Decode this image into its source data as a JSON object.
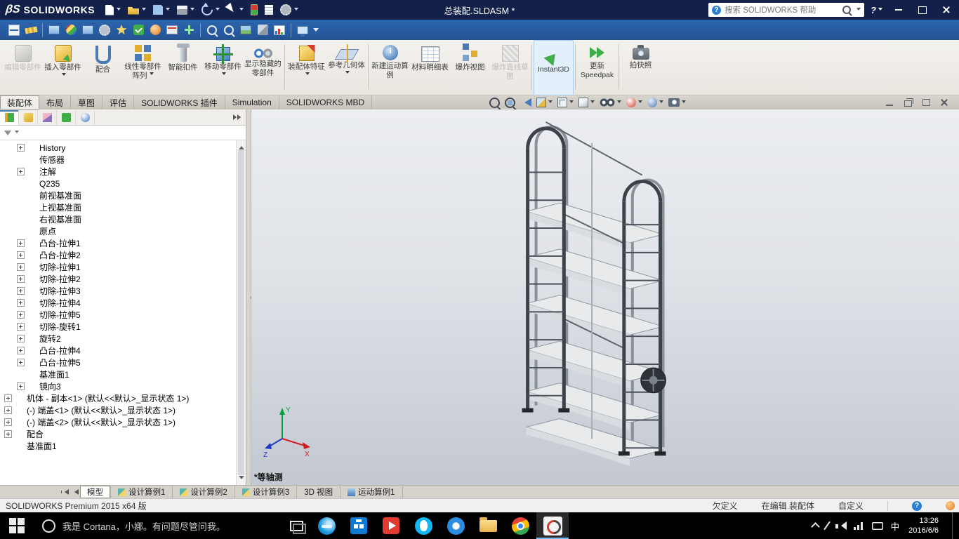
{
  "colors": {
    "titlebar": "#13204a",
    "toolbar": "#2a5fa8",
    "ribbon_bg": "#eceae5",
    "viewport_top": "#eceef1",
    "viewport_bottom": "#c3c8d1",
    "taskbar": "#000000",
    "taskbar_active_underline": "#76b9ed"
  },
  "titlebar": {
    "logo_mark": "βS",
    "logo_text": "SOLIDWORKS",
    "doc_title": "总装配.SLDASM *",
    "search_placeholder": "搜索 SOLIDWORKS 帮助",
    "quick_access": [
      {
        "name": "new-file-icon",
        "caret": true
      },
      {
        "name": "open-file-icon",
        "caret": true
      },
      {
        "name": "save-icon",
        "caret": true
      },
      {
        "name": "print-icon",
        "caret": true
      },
      {
        "name": "undo-icon",
        "caret": true
      },
      {
        "name": "select-icon",
        "caret": true
      },
      {
        "name": "rebuild-icon",
        "caret": false
      },
      {
        "name": "file-properties-icon",
        "caret": false
      },
      {
        "name": "options-icon",
        "caret": true
      }
    ]
  },
  "toolbar2": {
    "icons": [
      {
        "name": "smart-dimension-icon"
      },
      {
        "name": "measure-icon",
        "sep": true
      },
      {
        "name": "display-settings-icon"
      },
      {
        "name": "appearance-swatch-icon"
      },
      {
        "name": "texture-icon"
      },
      {
        "name": "options-gear-icon"
      },
      {
        "name": "selection-burst-icon"
      },
      {
        "name": "design-checker-icon"
      },
      {
        "name": "simulation-ball-icon"
      },
      {
        "name": "toolbox-icon"
      },
      {
        "name": "insert-plus-icon",
        "sep": true
      },
      {
        "name": "zoom-tool-icon"
      },
      {
        "name": "spell-check-icon"
      },
      {
        "name": "photoview-icon"
      },
      {
        "name": "utility-icon"
      },
      {
        "name": "costing-icon",
        "sep": true
      },
      {
        "name": "monitor-icon"
      },
      {
        "name": "toolbar-more-caret"
      }
    ]
  },
  "ribbon": {
    "buttons": [
      {
        "label": "编辑零部件",
        "icon": "edit-component-icon",
        "enabled": false
      },
      {
        "label": "插入零部件",
        "icon": "insert-component-icon",
        "caret": true
      },
      {
        "label": "配合",
        "icon": "mate-icon"
      },
      {
        "label": "线性零部件阵列",
        "icon": "linear-pattern-icon",
        "caret": true
      },
      {
        "label": "智能扣件",
        "icon": "smart-fasteners-icon"
      },
      {
        "label": "移动零部件",
        "icon": "move-component-icon",
        "caret": true
      },
      {
        "label": "显示隐藏的零部件",
        "icon": "show-hidden-icon",
        "sep": true
      },
      {
        "label": "装配体特征",
        "icon": "assembly-features-icon",
        "caret": true
      },
      {
        "label": "参考几何体",
        "icon": "reference-geometry-icon",
        "caret": true,
        "sep": true
      },
      {
        "label": "新建运动算例",
        "icon": "motion-study-icon"
      },
      {
        "label": "材料明细表",
        "icon": "bom-icon"
      },
      {
        "label": "爆炸视图",
        "icon": "exploded-view-icon"
      },
      {
        "label": "爆炸直线草图",
        "icon": "explode-line-icon",
        "enabled": false,
        "sep": true
      },
      {
        "label": "Instant3D",
        "icon": "instant3d-icon",
        "active": true,
        "sep": true
      },
      {
        "label": "更新Speedpak",
        "icon": "speedpak-icon",
        "sep": true
      },
      {
        "label": "拍快照",
        "icon": "snapshot-icon"
      }
    ]
  },
  "ribbon_tabs": {
    "tabs": [
      {
        "label": "装配体",
        "active": true
      },
      {
        "label": "布局"
      },
      {
        "label": "草图"
      },
      {
        "label": "评估"
      },
      {
        "label": "SOLIDWORKS 插件"
      },
      {
        "label": "Simulation"
      },
      {
        "label": "SOLIDWORKS MBD"
      }
    ]
  },
  "heads_up": {
    "icons": [
      {
        "name": "zoom-fit-icon"
      },
      {
        "name": "zoom-area-icon"
      },
      {
        "name": "previous-view-icon"
      },
      {
        "name": "section-view-icon",
        "caret": true
      },
      {
        "name": "view-orientation-icon",
        "caret": true
      },
      {
        "name": "display-style-icon",
        "caret": true
      },
      {
        "name": "hide-show-icon",
        "caret": true
      },
      {
        "name": "edit-appearance-icon",
        "caret": true
      },
      {
        "name": "apply-scene-icon",
        "caret": true
      },
      {
        "name": "view-settings-icon",
        "caret": true
      }
    ]
  },
  "doc_controls": {
    "icons": [
      "doc-minimize-icon",
      "doc-restore-icon",
      "doc-newwindow-icon",
      "doc-close-icon"
    ]
  },
  "panel": {
    "tabs": [
      "featuremanager-tab-icon",
      "propertymanager-tab-icon",
      "configurationmanager-tab-icon",
      "dimxpert-tab-icon",
      "displaymanager-tab-icon"
    ],
    "tree": [
      {
        "label": "History",
        "icon": "history-icon",
        "exp": true,
        "indent": 1
      },
      {
        "label": "传感器",
        "icon": "sensors-icon",
        "exp": false,
        "indent": 1
      },
      {
        "label": "注解",
        "icon": "annotations-icon",
        "exp": true,
        "indent": 1
      },
      {
        "label": "Q235",
        "icon": "material-icon",
        "exp": false,
        "indent": 1
      },
      {
        "label": "前视基准面",
        "icon": "plane-icon",
        "exp": false,
        "indent": 1
      },
      {
        "label": "上视基准面",
        "icon": "plane-icon",
        "exp": false,
        "indent": 1
      },
      {
        "label": "右视基准面",
        "icon": "plane-icon",
        "exp": false,
        "indent": 1
      },
      {
        "label": "原点",
        "icon": "origin-icon",
        "exp": false,
        "indent": 1
      },
      {
        "label": "凸台-拉伸1",
        "icon": "boss-extrude-icon",
        "exp": true,
        "indent": 1
      },
      {
        "label": "凸台-拉伸2",
        "icon": "boss-extrude-icon",
        "exp": true,
        "indent": 1
      },
      {
        "label": "切除-拉伸1",
        "icon": "cut-extrude-icon",
        "exp": true,
        "indent": 1
      },
      {
        "label": "切除-拉伸2",
        "icon": "cut-extrude-icon",
        "exp": true,
        "indent": 1
      },
      {
        "label": "切除-拉伸3",
        "icon": "cut-extrude-icon",
        "exp": true,
        "indent": 1
      },
      {
        "label": "切除-拉伸4",
        "icon": "cut-extrude-icon",
        "exp": true,
        "indent": 1
      },
      {
        "label": "切除-拉伸5",
        "icon": "cut-extrude-icon",
        "exp": true,
        "indent": 1
      },
      {
        "label": "切除-旋转1",
        "icon": "cut-revolve-icon",
        "exp": true,
        "indent": 1
      },
      {
        "label": "旋转2",
        "icon": "revolve-icon",
        "exp": true,
        "indent": 1
      },
      {
        "label": "凸台-拉伸4",
        "icon": "boss-extrude-icon",
        "exp": true,
        "indent": 1
      },
      {
        "label": "凸台-拉伸5",
        "icon": "boss-extrude-icon",
        "exp": true,
        "indent": 1
      },
      {
        "label": "基准面1",
        "icon": "plane-icon",
        "exp": false,
        "indent": 1
      },
      {
        "label": "镜向3",
        "icon": "mirror-icon",
        "exp": true,
        "indent": 1
      },
      {
        "label": "机体 - 副本<1> (默认<<默认>_显示状态 1>)",
        "icon": "component-icon",
        "exp": true,
        "indent": 0
      },
      {
        "label": "(-) 端盖<1> (默认<<默认>_显示状态 1>)",
        "icon": "component-icon",
        "exp": true,
        "indent": 0
      },
      {
        "label": "(-) 端盖<2> (默认<<默认>_显示状态 1>)",
        "icon": "component-icon",
        "exp": true,
        "indent": 0
      },
      {
        "label": "配合",
        "icon": "mates-icon",
        "exp": true,
        "indent": 0
      },
      {
        "label": "基准面1",
        "icon": "plane-icon",
        "exp": false,
        "indent": 0
      }
    ]
  },
  "viewport": {
    "view_label": "*等轴测",
    "triad": {
      "x": "X",
      "y": "Y",
      "z": "Z"
    }
  },
  "model_tabs": {
    "scrollers": [
      "tab-scroll-start-icon",
      "tab-scroll-prev-icon"
    ],
    "tabs": [
      {
        "label": "模型",
        "active": true
      },
      {
        "label": "设计算例1",
        "icon": "design-study-icon"
      },
      {
        "label": "设计算例2",
        "icon": "design-study-icon"
      },
      {
        "label": "设计算例3",
        "icon": "design-study-icon"
      },
      {
        "label": "3D 视图"
      },
      {
        "label": "运动算例1",
        "icon": "motion-study-tab-icon"
      }
    ]
  },
  "statusbar": {
    "left": "SOLIDWORKS Premium 2015 x64 版",
    "defined_state": "欠定义",
    "editing": "在编辑 装配体",
    "custom": "自定义"
  },
  "taskbar": {
    "cortana_text": "我是 Cortana，小娜。有问题尽管问我。",
    "apps": [
      {
        "name": "edge-icon"
      },
      {
        "name": "store-icon"
      },
      {
        "name": "media-app-icon"
      },
      {
        "name": "qq-icon"
      },
      {
        "name": "browser-icon"
      },
      {
        "name": "file-explorer-icon"
      },
      {
        "name": "chrome-icon"
      },
      {
        "name": "solidworks-icon",
        "active": true
      }
    ],
    "tray_icons": [
      "chevron-up-icon",
      "pen-icon",
      "volume-icon",
      "network-icon",
      "keyboard-icon"
    ],
    "ime": "中",
    "time": "13:26",
    "date": "2016/6/6"
  }
}
